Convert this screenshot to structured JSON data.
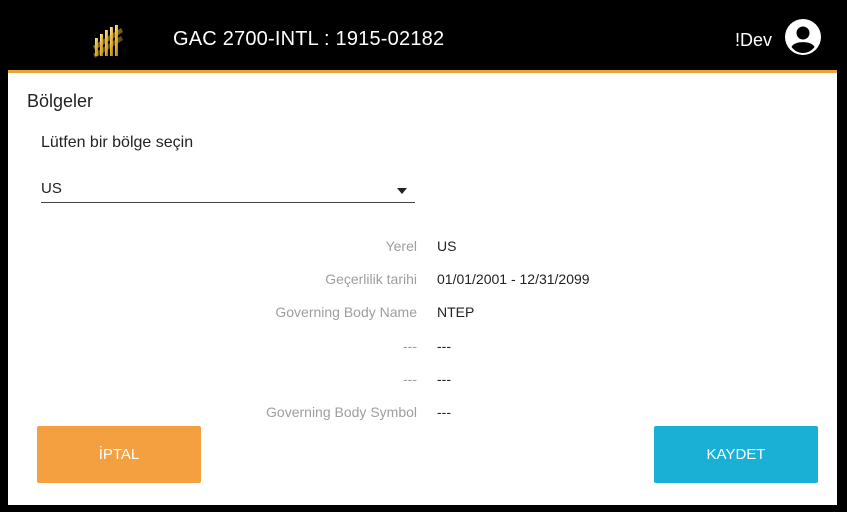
{
  "header": {
    "title": "GAC 2700-INTL : 1915-02182",
    "user_label": "!Dev",
    "logo_icon": "gac-logo-icon",
    "user_icon": "account-circle-icon"
  },
  "page": {
    "section_title": "Bölgeler",
    "prompt": "Lütfen bir bölge seçin",
    "region_select": {
      "value": "US"
    }
  },
  "details": [
    {
      "label": "Yerel",
      "value": "US"
    },
    {
      "label": "Geçerlilik tarihi",
      "value": "01/01/2001 - 12/31/2099"
    },
    {
      "label": "Governing Body Name",
      "value": "NTEP"
    },
    {
      "label": "---",
      "value": "---"
    },
    {
      "label": "---",
      "value": "---"
    },
    {
      "label": "Governing Body Symbol",
      "value": "---"
    }
  ],
  "buttons": {
    "cancel": "İPTAL",
    "save": "KAYDET"
  },
  "colors": {
    "header_bg": "#000000",
    "accent": "#e8a43a",
    "cancel_bg": "#f5a040",
    "save_bg": "#1ab0d5"
  }
}
